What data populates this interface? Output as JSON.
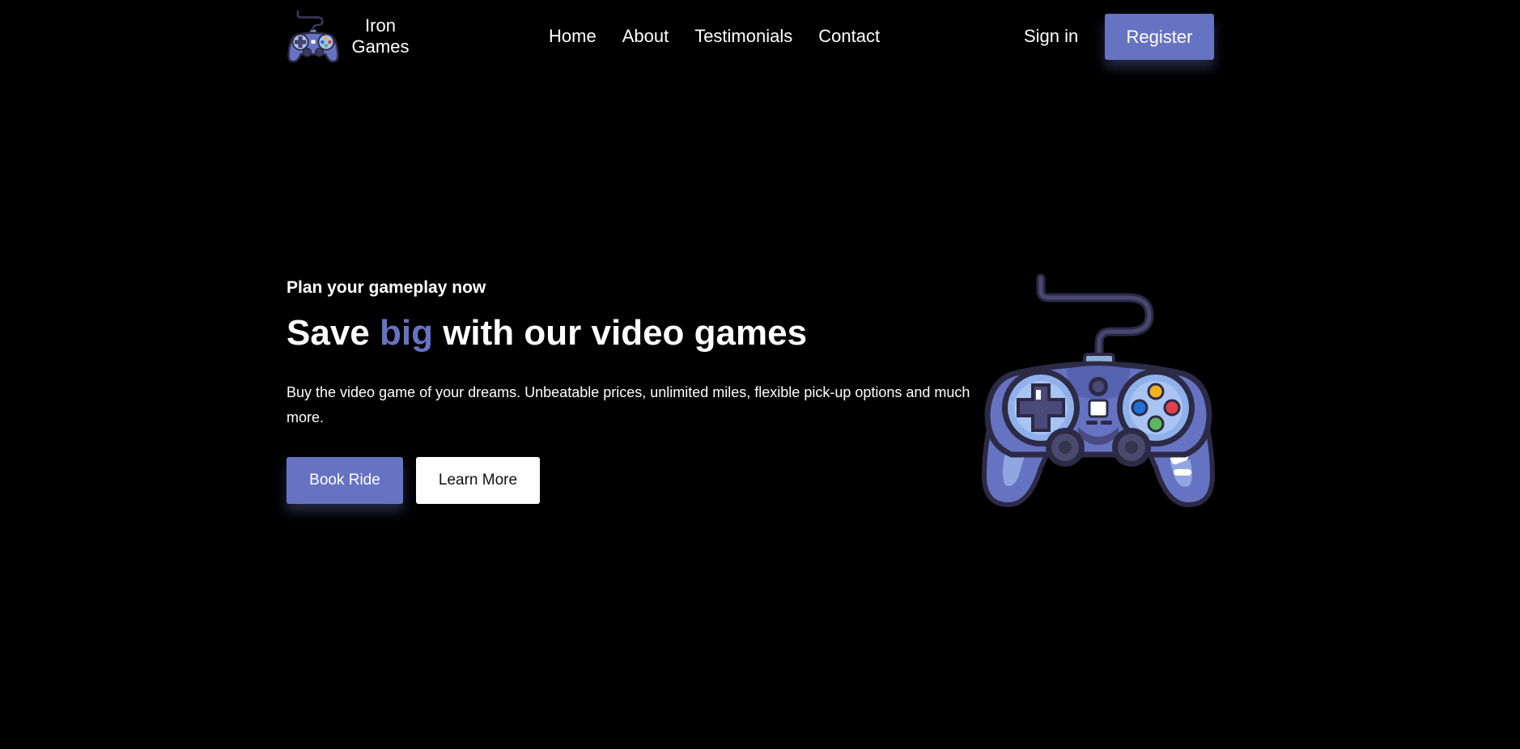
{
  "brand": {
    "name_line1": "Iron",
    "name_line2": "Games",
    "logo_icon": "gamepad-icon"
  },
  "nav": {
    "links": [
      {
        "label": "Home"
      },
      {
        "label": "About"
      },
      {
        "label": "Testimonials"
      },
      {
        "label": "Contact"
      }
    ],
    "signin_label": "Sign in",
    "register_label": "Register"
  },
  "hero": {
    "subtitle": "Plan your gameplay now",
    "title_before": "Save ",
    "title_accent": "big",
    "title_after": " with our video games",
    "description": "Buy the video game of your dreams. Unbeatable prices, unlimited miles, flexible pick-up options and much more.",
    "primary_button": "Book Ride",
    "secondary_button": "Learn More",
    "image_icon": "gamepad-icon"
  },
  "colors": {
    "background": "#000000",
    "accent": "#6673c2",
    "text": "#ffffff",
    "secondary_button_bg": "#ffffff",
    "secondary_button_text": "#111111"
  }
}
